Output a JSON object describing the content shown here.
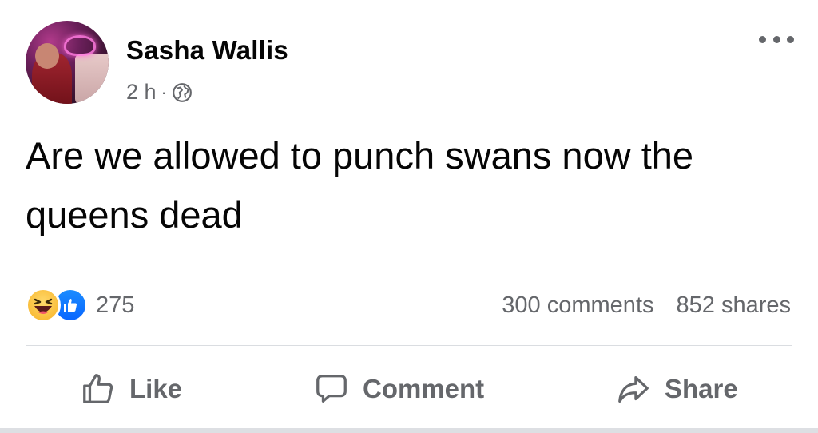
{
  "post": {
    "author": "Sasha Wallis",
    "time": "2 h",
    "separator": "·",
    "privacy_icon": "globe-icon",
    "text": "Are we allowed to punch swans now the queens dead",
    "menu_icon": "more-options-icon"
  },
  "stats": {
    "reactions": [
      "haha",
      "like"
    ],
    "reaction_count": "275",
    "comments": "300 comments",
    "shares": "852 shares"
  },
  "actions": {
    "like_label": "Like",
    "comment_label": "Comment",
    "share_label": "Share"
  },
  "colors": {
    "text": "#050505",
    "secondary": "#65676b",
    "like_blue": "#0866ff",
    "haha_yellow": "#f7b125",
    "divider": "#dadde1"
  }
}
